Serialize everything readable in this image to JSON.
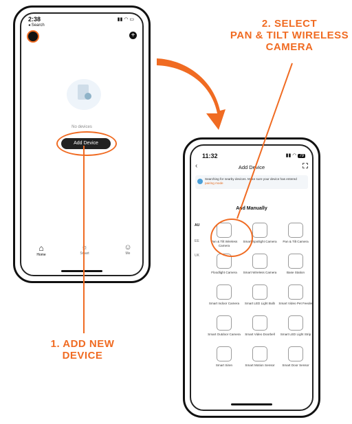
{
  "annotations": {
    "step2": [
      "2. SELECT",
      "PAN & TILT WIRELESS",
      "CAMERA"
    ],
    "step1": [
      "1. ADD NEW",
      "DEVICE"
    ],
    "accent_color": "#f06b22"
  },
  "phone1": {
    "time": "2:38",
    "back_link": "◂ Search",
    "empty_text": "No devices",
    "add_device_label": "Add Device",
    "tabs": [
      {
        "label": "Home",
        "icon": "home-icon"
      },
      {
        "label": "Smart",
        "icon": "sun-icon"
      },
      {
        "label": "Me",
        "icon": "person-icon"
      }
    ]
  },
  "phone2": {
    "time": "11:32",
    "battery": "79",
    "title": "Add Device",
    "search_notice": "Searching for nearby devices. Make sure your device has entered",
    "search_link": "pairing mode",
    "section_title": "Add Manually",
    "side_labels": [
      "AU",
      "EE",
      "UK"
    ],
    "devices": [
      {
        "label": "Pan & Tilt Wireless Camera",
        "icon": "ptz-camera-icon"
      },
      {
        "label": "Smart Spotlight Camera",
        "icon": "spotlight-camera-icon"
      },
      {
        "label": "Pan & Tilt Camera",
        "icon": "dome-camera-icon"
      },
      {
        "label": "Floodlight Camera",
        "icon": "floodlight-camera-icon"
      },
      {
        "label": "Smart Wireless Camera",
        "icon": "wireless-camera-icon"
      },
      {
        "label": "Base Station",
        "icon": "base-station-icon"
      },
      {
        "label": "Smart Indoor Camera",
        "icon": "indoor-camera-icon"
      },
      {
        "label": "Smart LED Light Bulb",
        "icon": "bulb-icon"
      },
      {
        "label": "Smart Video Pet Feeder",
        "icon": "pet-feeder-icon"
      },
      {
        "label": "Smart Outdoor Camera",
        "icon": "outdoor-camera-icon"
      },
      {
        "label": "Smart Video Doorbell",
        "icon": "doorbell-icon"
      },
      {
        "label": "Smart LED Light Strip",
        "icon": "light-strip-icon"
      },
      {
        "label": "Smart Siren",
        "icon": "siren-icon"
      },
      {
        "label": "Smart Motion Sensor",
        "icon": "motion-sensor-icon"
      },
      {
        "label": "Smart Door Sensor",
        "icon": "door-sensor-icon"
      }
    ]
  }
}
